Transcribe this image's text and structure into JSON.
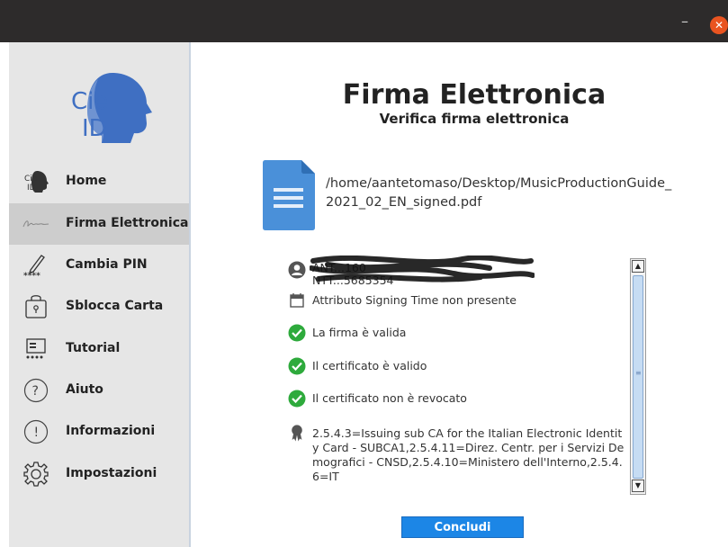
{
  "window": {
    "minimize": "–",
    "close": "✕"
  },
  "logo": {
    "line1": "Cie",
    "line2": "ID"
  },
  "sidebar": {
    "items": [
      {
        "label": "Home",
        "icon": "cie-icon"
      },
      {
        "label": "Firma Elettronica",
        "icon": "signature-icon",
        "active": true
      },
      {
        "label": "Cambia PIN",
        "icon": "pen-pin-icon"
      },
      {
        "label": "Sblocca Carta",
        "icon": "unlock-card-icon"
      },
      {
        "label": "Tutorial",
        "icon": "tutorial-icon"
      },
      {
        "label": "Aiuto",
        "icon": "help-icon"
      },
      {
        "label": "Informazioni",
        "icon": "info-icon"
      },
      {
        "label": "Impostazioni",
        "icon": "gear-icon"
      }
    ]
  },
  "main": {
    "title": "Firma Elettronica",
    "subtitle": "Verifica firma elettronica",
    "file_path": "/home/aantetomaso/Desktop/MusicProductionGuide_2021_02_EN_signed.pdf"
  },
  "details": {
    "signer_line1": "ANT...160",
    "signer_line2": "NTT...5685354",
    "signing_time": "Attributo Signing Time non presente",
    "valid_signature": "La firma è valida",
    "valid_certificate": "Il certificato è valido",
    "not_revoked": "Il certificato non è revocato",
    "issuer": "2.5.4.3=Issuing sub CA for the Italian Electronic Identity Card - SUBCA1,2.5.4.11=Direz. Centr. per i Servizi Demografici - CNSD,2.5.4.10=Ministero dell'Interno,2.5.4.6=IT"
  },
  "buttons": {
    "conclude": "Concludi"
  },
  "colors": {
    "accent": "#1c86e6",
    "check": "#2eaa3c",
    "logo_blue": "#3f6fc2",
    "titlebar": "#2d2b2b",
    "close": "#e95420"
  }
}
